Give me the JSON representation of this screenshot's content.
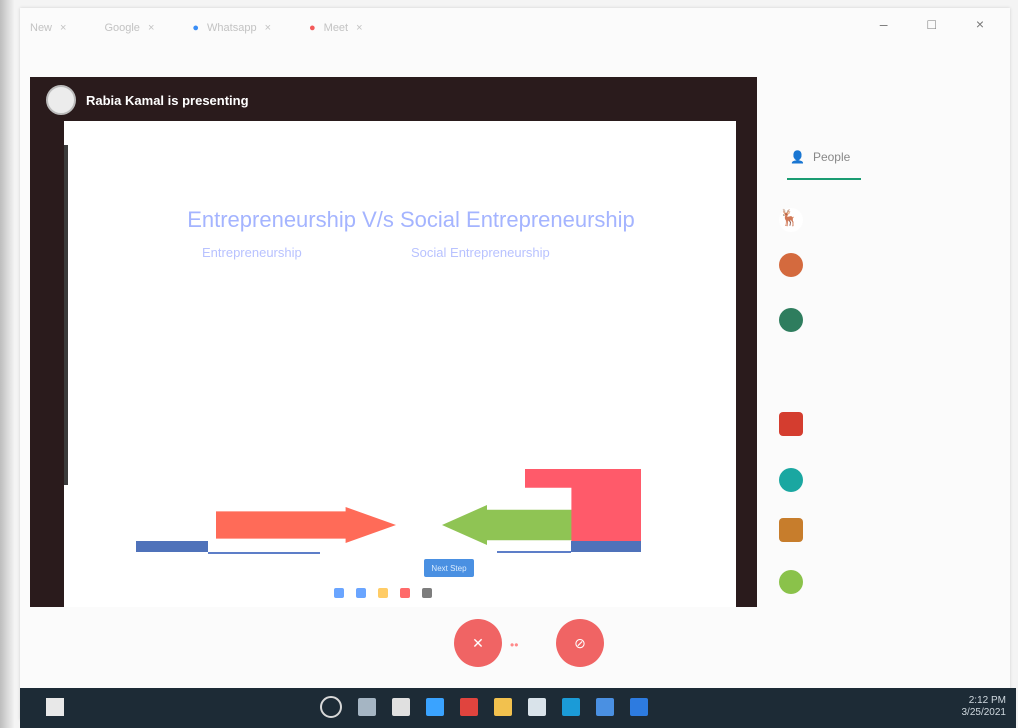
{
  "browser": {
    "tabs": [
      "New",
      "Google",
      "Whatsapp",
      "Meet"
    ],
    "address": "",
    "window_controls": "– □ ×"
  },
  "meeting": {
    "presenter_text": "Rabia Kamal is presenting",
    "slide_title": "Entrepreneurship V/s Social Entrepreneurship",
    "left_heading": "Entrepreneurship",
    "right_heading": "Social Entrepreneurship",
    "next_button": "Next Step"
  },
  "sidebar": {
    "people_tab_label": "People"
  },
  "colors": {
    "presenter_bg": "#2a1b1c",
    "accent_blue": "#4a90e2",
    "accent_green": "#1a9c72",
    "call_red": "#f06464"
  },
  "taskbar": {
    "time": "2:12 PM",
    "date": "3/25/2021"
  }
}
